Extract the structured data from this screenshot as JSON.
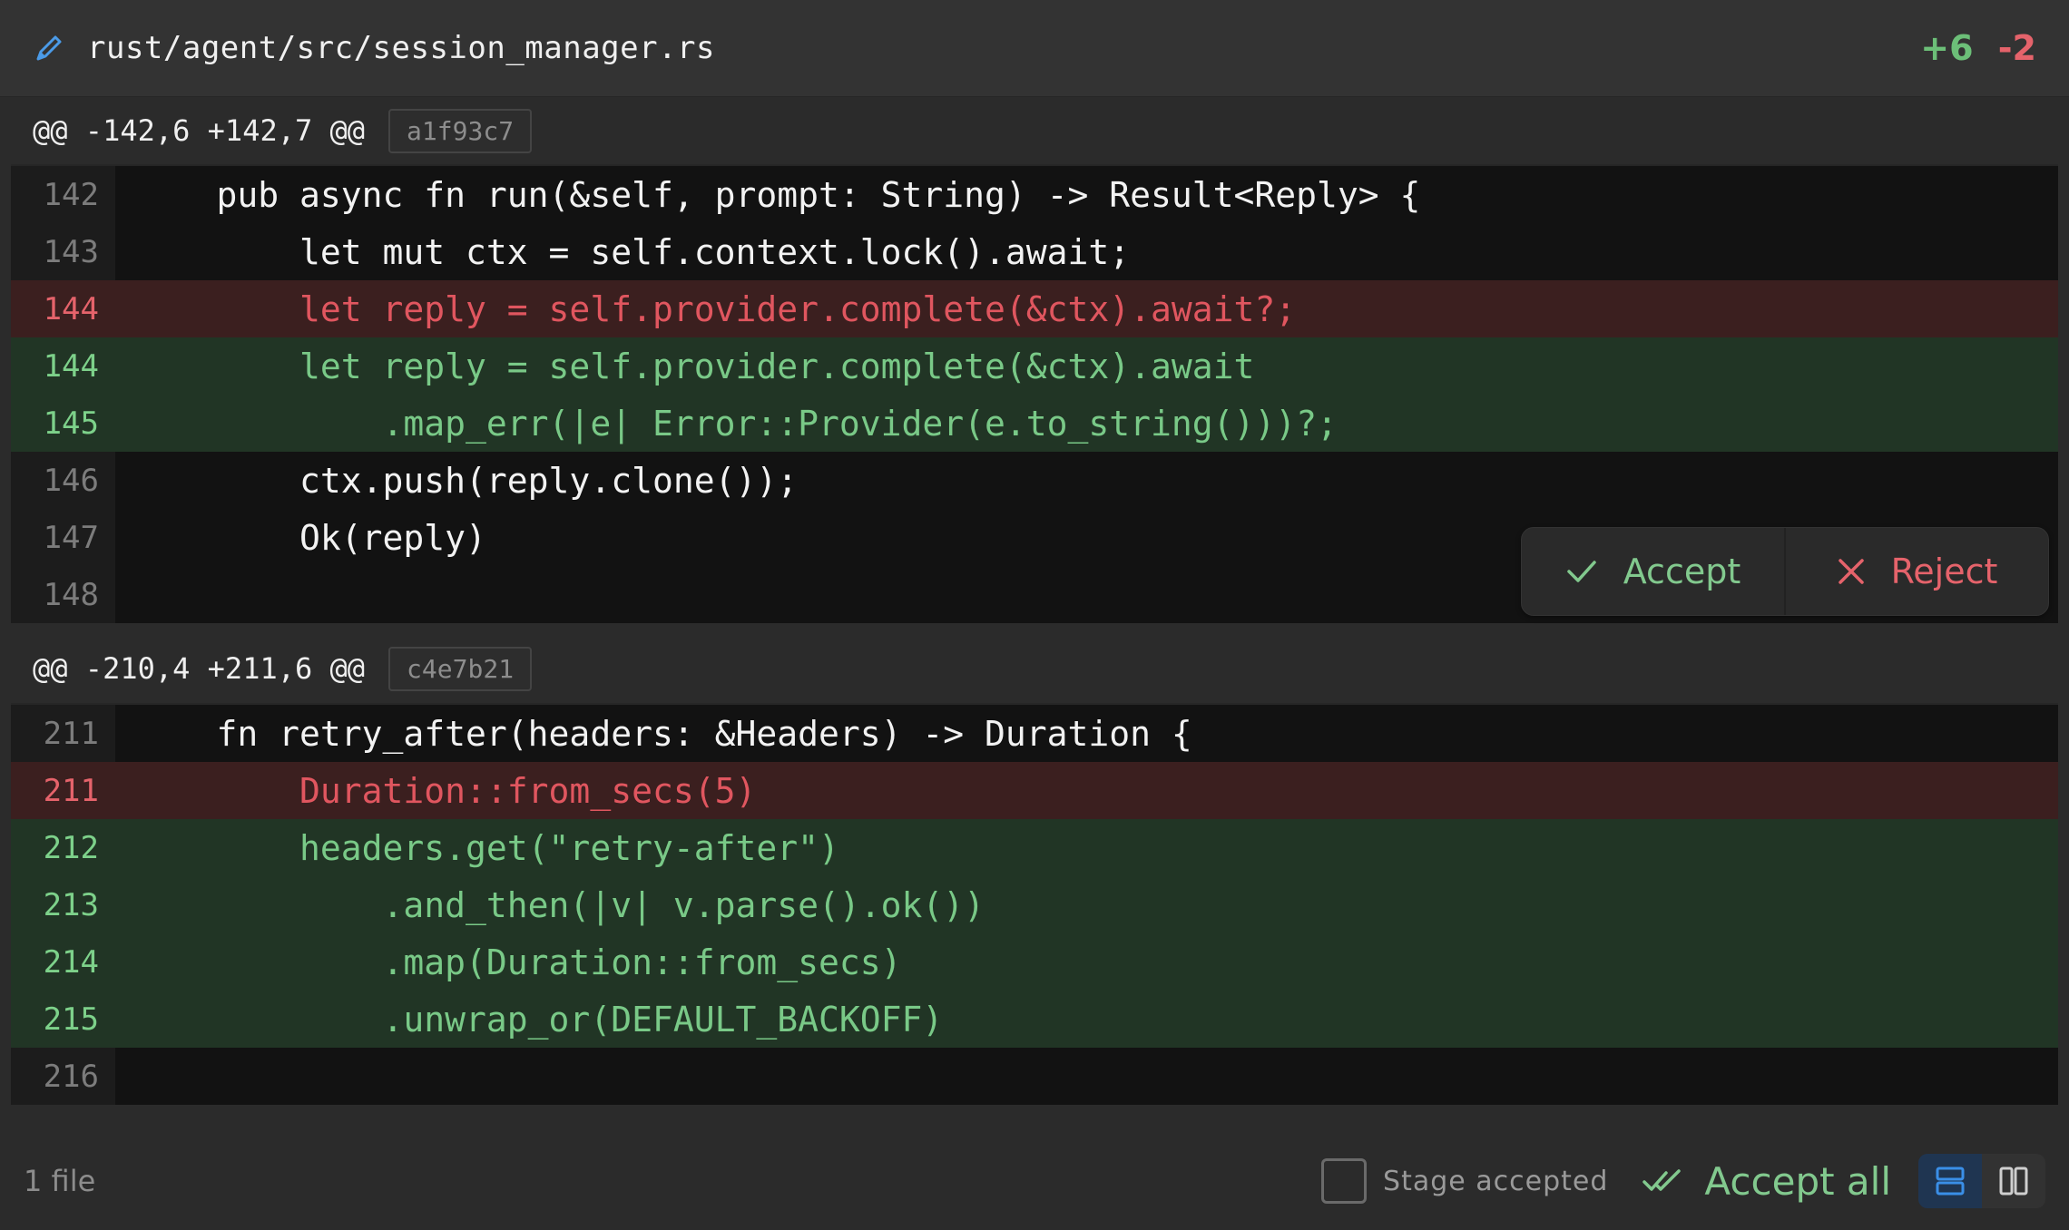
{
  "header": {
    "file_path": "rust/agent/src/session_manager.rs",
    "additions": "+6",
    "deletions": "-2"
  },
  "hunks": [
    {
      "range": "@@ -142,6 +142,7 @@",
      "hash": "a1f93c7",
      "lines": [
        {
          "num": "142",
          "type": "ctx",
          "text": "    pub async fn run(&self, prompt: String) -> Result<Reply> {"
        },
        {
          "num": "143",
          "type": "ctx",
          "text": "        let mut ctx = self.context.lock().await;"
        },
        {
          "num": "144",
          "type": "del",
          "text": "        let reply = self.provider.complete(&ctx).await?;"
        },
        {
          "num": "144",
          "type": "add",
          "text": "        let reply = self.provider.complete(&ctx).await"
        },
        {
          "num": "145",
          "type": "add",
          "text": "            .map_err(|e| Error::Provider(e.to_string()))?;"
        },
        {
          "num": "146",
          "type": "ctx",
          "text": "        ctx.push(reply.clone());"
        },
        {
          "num": "147",
          "type": "ctx",
          "text": "        Ok(reply)"
        },
        {
          "num": "148",
          "type": "ctx",
          "text": ""
        }
      ]
    },
    {
      "range": "@@ -210,4 +211,6 @@",
      "hash": "c4e7b21",
      "lines": [
        {
          "num": "211",
          "type": "ctx",
          "text": "    fn retry_after(headers: &Headers) -> Duration {"
        },
        {
          "num": "211",
          "type": "del",
          "text": "        Duration::from_secs(5)"
        },
        {
          "num": "212",
          "type": "add",
          "text": "        headers.get(\"retry-after\")"
        },
        {
          "num": "213",
          "type": "add",
          "text": "            .and_then(|v| v.parse().ok())"
        },
        {
          "num": "214",
          "type": "add",
          "text": "            .map(Duration::from_secs)"
        },
        {
          "num": "215",
          "type": "add",
          "text": "            .unwrap_or(DEFAULT_BACKOFF)"
        },
        {
          "num": "216",
          "type": "ctx",
          "text": ""
        }
      ]
    }
  ],
  "actions": {
    "accept_label": "Accept",
    "reject_label": "Reject"
  },
  "footer": {
    "file_count": "1 file",
    "stage_label": "Stage accepted",
    "accept_all_label": "Accept all"
  },
  "colors": {
    "added": "#79c987",
    "deleted": "#e0565f",
    "accent": "#3a8fe8"
  }
}
